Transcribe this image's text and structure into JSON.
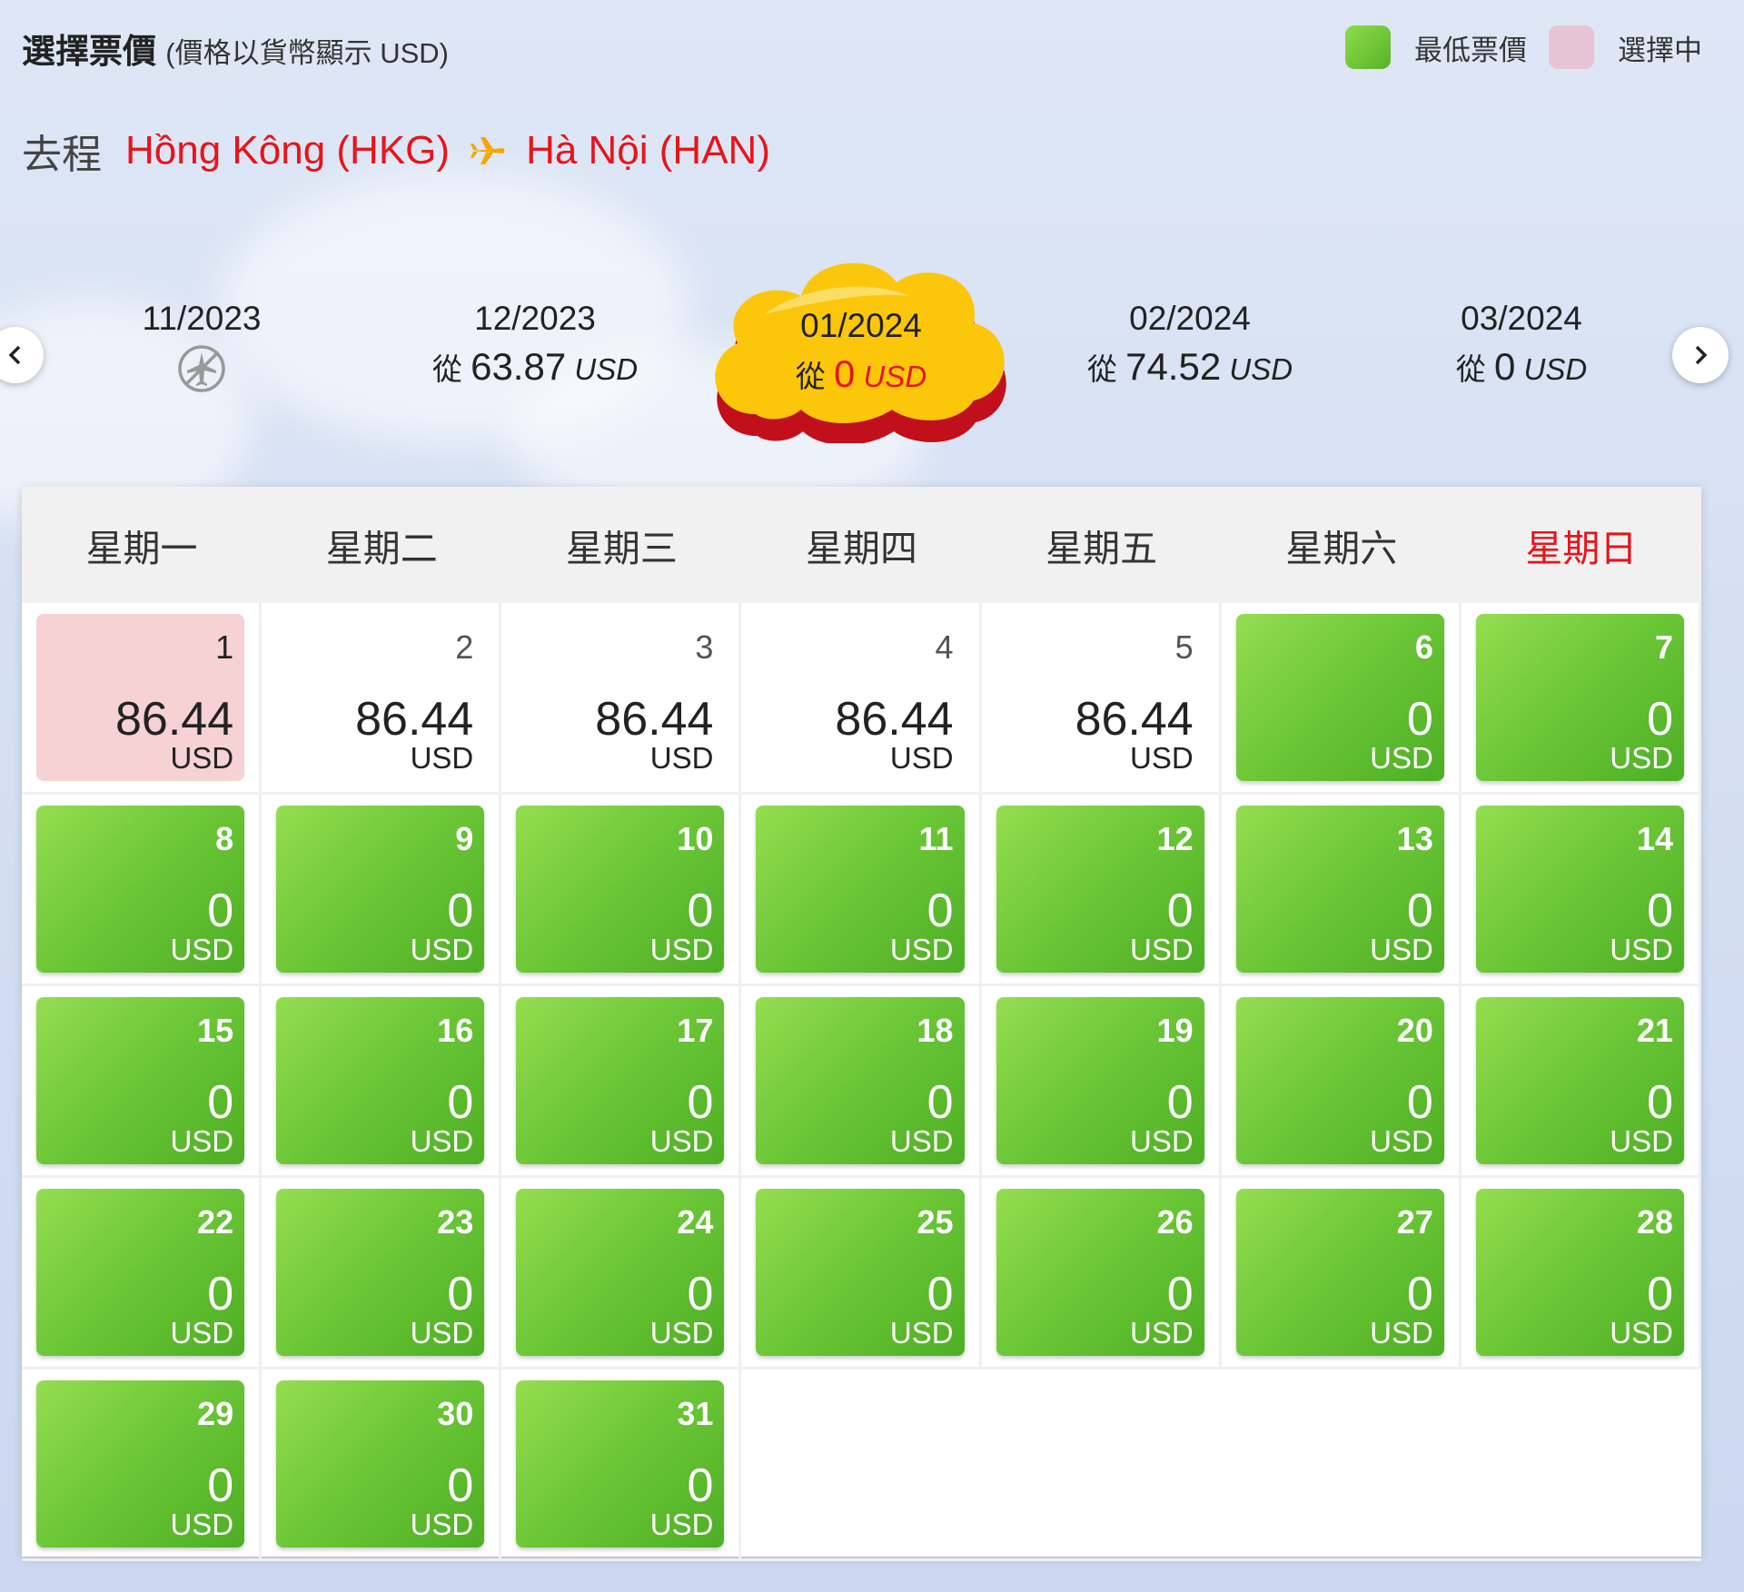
{
  "header": {
    "title": "選擇票價",
    "subtitle": "(價格以貨幣顯示 USD)",
    "legend": [
      {
        "label": "最低票價",
        "color": "#6ac636"
      },
      {
        "label": "選擇中",
        "color": "#e7c3d6"
      }
    ]
  },
  "route": {
    "label": "去程",
    "from": "Hồng Kông (HKG)",
    "to": "Hà Nội (HAN)",
    "accent": "#e8141a"
  },
  "months": [
    {
      "date": "11/2023",
      "status": "no-flight-icon"
    },
    {
      "date": "12/2023",
      "prefix": "從",
      "amount": "63.87",
      "currency": "USD"
    },
    {
      "date": "01/2024",
      "prefix": "從",
      "amount": "0",
      "currency": "USD",
      "selected": true
    },
    {
      "date": "02/2024",
      "prefix": "從",
      "amount": "74.52",
      "currency": "USD"
    },
    {
      "date": "03/2024",
      "prefix": "從",
      "amount": "0",
      "currency": "USD"
    }
  ],
  "weekdays": [
    "星期一",
    "星期二",
    "星期三",
    "星期四",
    "星期五",
    "星期六",
    "星期日"
  ],
  "days": [
    {
      "day": "1",
      "amount": "86.44",
      "currency": "USD",
      "state": "selected"
    },
    {
      "day": "2",
      "amount": "86.44",
      "currency": "USD",
      "state": "normal"
    },
    {
      "day": "3",
      "amount": "86.44",
      "currency": "USD",
      "state": "normal"
    },
    {
      "day": "4",
      "amount": "86.44",
      "currency": "USD",
      "state": "normal"
    },
    {
      "day": "5",
      "amount": "86.44",
      "currency": "USD",
      "state": "normal"
    },
    {
      "day": "6",
      "amount": "0",
      "currency": "USD",
      "state": "lowest"
    },
    {
      "day": "7",
      "amount": "0",
      "currency": "USD",
      "state": "lowest"
    },
    {
      "day": "8",
      "amount": "0",
      "currency": "USD",
      "state": "lowest"
    },
    {
      "day": "9",
      "amount": "0",
      "currency": "USD",
      "state": "lowest"
    },
    {
      "day": "10",
      "amount": "0",
      "currency": "USD",
      "state": "lowest"
    },
    {
      "day": "11",
      "amount": "0",
      "currency": "USD",
      "state": "lowest"
    },
    {
      "day": "12",
      "amount": "0",
      "currency": "USD",
      "state": "lowest"
    },
    {
      "day": "13",
      "amount": "0",
      "currency": "USD",
      "state": "lowest"
    },
    {
      "day": "14",
      "amount": "0",
      "currency": "USD",
      "state": "lowest"
    },
    {
      "day": "15",
      "amount": "0",
      "currency": "USD",
      "state": "lowest"
    },
    {
      "day": "16",
      "amount": "0",
      "currency": "USD",
      "state": "lowest"
    },
    {
      "day": "17",
      "amount": "0",
      "currency": "USD",
      "state": "lowest"
    },
    {
      "day": "18",
      "amount": "0",
      "currency": "USD",
      "state": "lowest"
    },
    {
      "day": "19",
      "amount": "0",
      "currency": "USD",
      "state": "lowest"
    },
    {
      "day": "20",
      "amount": "0",
      "currency": "USD",
      "state": "lowest"
    },
    {
      "day": "21",
      "amount": "0",
      "currency": "USD",
      "state": "lowest"
    },
    {
      "day": "22",
      "amount": "0",
      "currency": "USD",
      "state": "lowest"
    },
    {
      "day": "23",
      "amount": "0",
      "currency": "USD",
      "state": "lowest"
    },
    {
      "day": "24",
      "amount": "0",
      "currency": "USD",
      "state": "lowest"
    },
    {
      "day": "25",
      "amount": "0",
      "currency": "USD",
      "state": "lowest"
    },
    {
      "day": "26",
      "amount": "0",
      "currency": "USD",
      "state": "lowest"
    },
    {
      "day": "27",
      "amount": "0",
      "currency": "USD",
      "state": "lowest"
    },
    {
      "day": "28",
      "amount": "0",
      "currency": "USD",
      "state": "lowest"
    },
    {
      "day": "29",
      "amount": "0",
      "currency": "USD",
      "state": "lowest"
    },
    {
      "day": "30",
      "amount": "0",
      "currency": "USD",
      "state": "lowest"
    },
    {
      "day": "31",
      "amount": "0",
      "currency": "USD",
      "state": "lowest"
    }
  ]
}
